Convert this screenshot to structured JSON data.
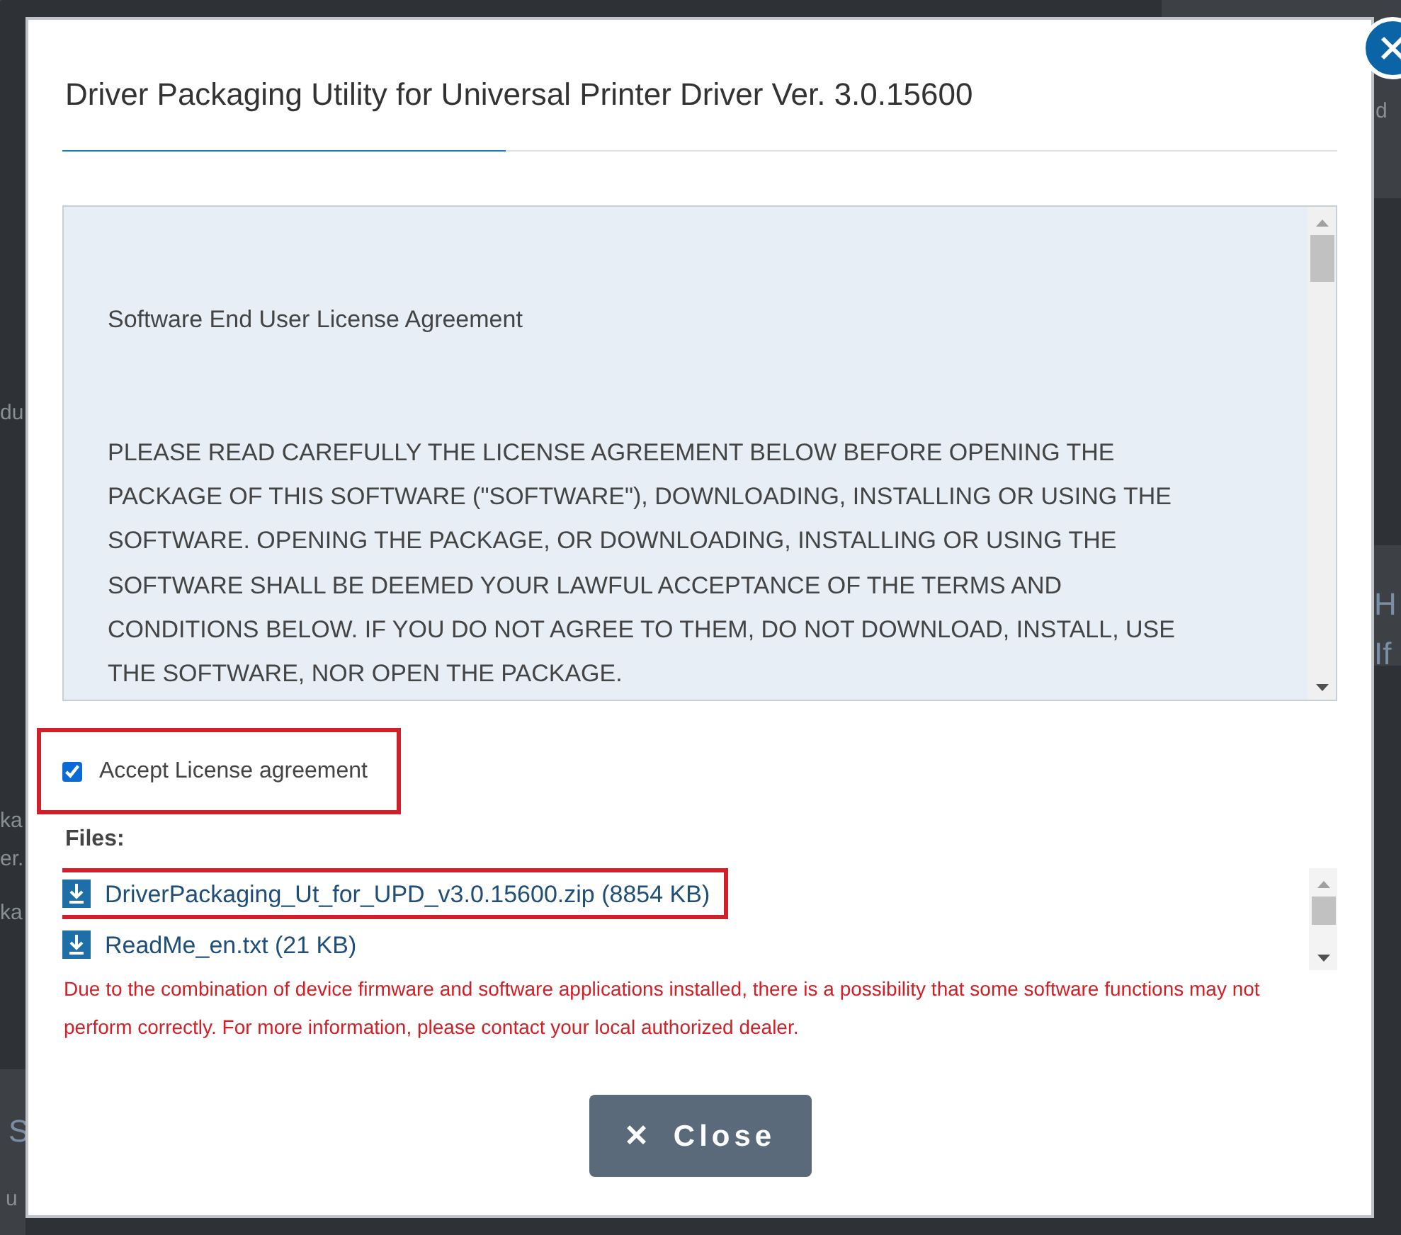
{
  "background_fragments": [
    "d",
    "du",
    "ka",
    "er.",
    "ka",
    "H",
    "If",
    "S",
    "u"
  ],
  "dialog": {
    "title": "Driver Packaging Utility for Universal Printer Driver Ver. 3.0.15600",
    "license": {
      "heading": "Software End User License Agreement",
      "body": "PLEASE READ CAREFULLY THE LICENSE AGREEMENT BELOW BEFORE OPENING THE PACKAGE OF THIS SOFTWARE (\"SOFTWARE\"), DOWNLOADING, INSTALLING OR USING THE SOFTWARE. OPENING THE PACKAGE, OR DOWNLOADING, INSTALLING OR USING THE SOFTWARE SHALL BE DEEMED YOUR LAWFUL ACCEPTANCE OF THE TERMS AND CONDITIONS BELOW. IF YOU DO NOT AGREE TO THEM, DO NOT DOWNLOAD, INSTALL, USE THE SOFTWARE, NOR OPEN THE PACKAGE."
    },
    "accept": {
      "label": "Accept License agreement",
      "checked": true,
      "highlighted": true
    },
    "files_label": "Files:",
    "files": [
      {
        "name": "DriverPackaging_Ut_for_UPD_v3.0.15600.zip (8854 KB)",
        "highlighted": true
      },
      {
        "name": "ReadMe_en.txt (21 KB)",
        "highlighted": false
      }
    ],
    "warning": "Due to the combination of device firmware and software applications installed, there is a possibility that some software functions may not perform correctly. For more information, please contact your local authorized dealer.",
    "close_button": {
      "icon": "✕",
      "label": "Close"
    }
  }
}
